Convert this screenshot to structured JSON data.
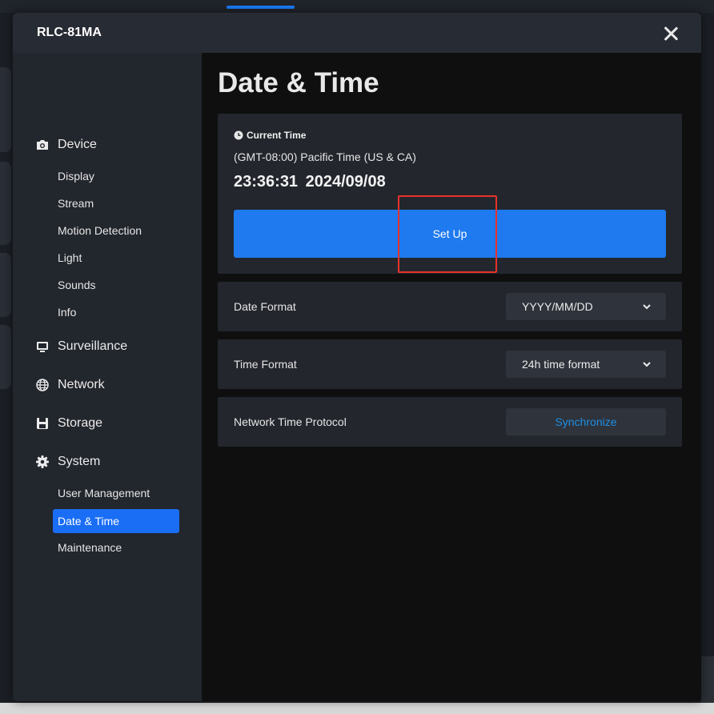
{
  "window": {
    "title": "RLC-81MA"
  },
  "sidebar": {
    "sections": [
      {
        "label": "Device",
        "icon": "camera-icon",
        "items": [
          "Display",
          "Stream",
          "Motion Detection",
          "Light",
          "Sounds",
          "Info"
        ]
      },
      {
        "label": "Surveillance",
        "icon": "monitor-icon",
        "items": []
      },
      {
        "label": "Network",
        "icon": "globe-icon",
        "items": []
      },
      {
        "label": "Storage",
        "icon": "floppy-disk-icon",
        "items": []
      },
      {
        "label": "System",
        "icon": "gear-icon",
        "items": [
          "User Management",
          "Date & Time",
          "Maintenance"
        ]
      }
    ],
    "active_item": "Date & Time"
  },
  "main": {
    "page_title": "Date & Time",
    "current_time": {
      "label": "Current Time",
      "icon": "clock-icon",
      "timezone": "(GMT-08:00) Pacific Time (US & CA)",
      "time": "23:36:31",
      "date": "2024/09/08",
      "setup_label": "Set Up"
    },
    "date_format": {
      "label": "Date Format",
      "selected": "YYYY/MM/DD"
    },
    "time_format": {
      "label": "Time Format",
      "selected": "24h time format"
    },
    "ntp": {
      "label": "Network Time Protocol",
      "button_label": "Synchronize"
    }
  },
  "colors": {
    "accent": "#1f7af0",
    "active_nav": "#1a6ef5",
    "highlight": "#e8322b",
    "link": "#1e8fe6"
  }
}
